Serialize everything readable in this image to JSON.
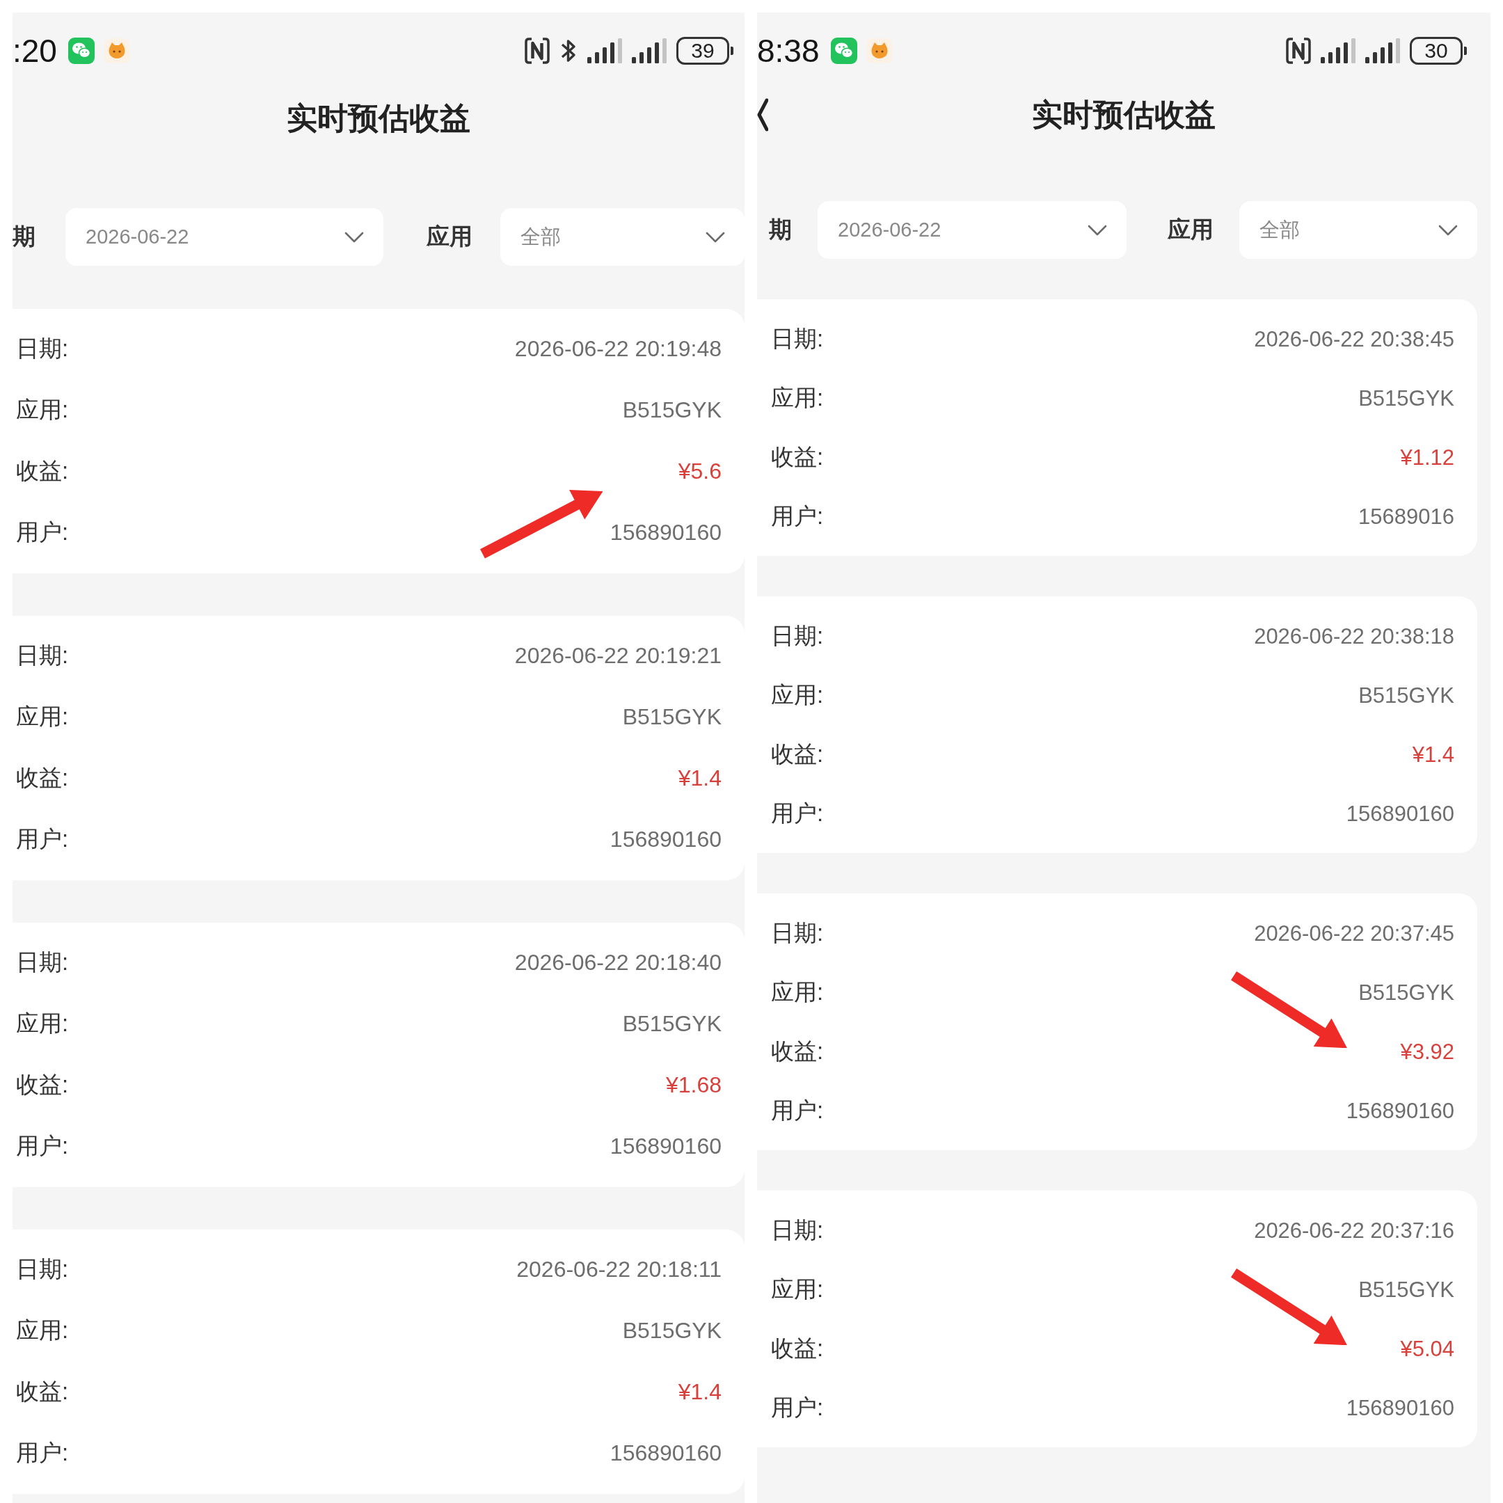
{
  "screens": [
    {
      "status_bar": {
        "time": ":20",
        "bluetooth": true,
        "battery": "39"
      },
      "nav_bar": {
        "title": "实时预估收益"
      },
      "filters": [
        {
          "label": "期",
          "value": "2026-06-22"
        },
        {
          "label": "应用",
          "value": "全部"
        }
      ],
      "records": [
        {
          "arrow": {
            "kind": "up-right"
          },
          "fields": [
            {
              "kind": "text",
              "label": "日期:",
              "value": "2026-06-22 20:19:48"
            },
            {
              "kind": "text",
              "label": "应用:",
              "value": "B515GYK"
            },
            {
              "kind": "amount",
              "label": "收益:",
              "value": "¥5.6"
            },
            {
              "kind": "text",
              "label": "用户:",
              "value": "156890160"
            }
          ]
        },
        {
          "fields": [
            {
              "kind": "text",
              "label": "日期:",
              "value": "2026-06-22 20:19:21"
            },
            {
              "kind": "text",
              "label": "应用:",
              "value": "B515GYK"
            },
            {
              "kind": "amount",
              "label": "收益:",
              "value": "¥1.4"
            },
            {
              "kind": "text",
              "label": "用户:",
              "value": "156890160"
            }
          ]
        },
        {
          "fields": [
            {
              "kind": "text",
              "label": "日期:",
              "value": "2026-06-22 20:18:40"
            },
            {
              "kind": "text",
              "label": "应用:",
              "value": "B515GYK"
            },
            {
              "kind": "amount",
              "label": "收益:",
              "value": "¥1.68"
            },
            {
              "kind": "text",
              "label": "用户:",
              "value": "156890160"
            }
          ]
        },
        {
          "fields": [
            {
              "kind": "text",
              "label": "日期:",
              "value": "2026-06-22 20:18:11"
            },
            {
              "kind": "text",
              "label": "应用:",
              "value": "B515GYK"
            },
            {
              "kind": "amount",
              "label": "收益:",
              "value": "¥1.4"
            },
            {
              "kind": "text",
              "label": "用户:",
              "value": "156890160"
            }
          ]
        }
      ]
    },
    {
      "status_bar": {
        "time": "8:38",
        "battery": "30"
      },
      "nav_bar": {
        "title": "实时预估收益",
        "back_button": true
      },
      "filters": [
        {
          "label": "期",
          "value": "2026-06-22"
        },
        {
          "label": "应用",
          "value": "全部"
        }
      ],
      "records": [
        {
          "fields": [
            {
              "kind": "text",
              "label": "日期:",
              "value": "2026-06-22 20:38:45"
            },
            {
              "kind": "text",
              "label": "应用:",
              "value": "B515GYK"
            },
            {
              "kind": "amount",
              "label": "收益:",
              "value": "¥1.12"
            },
            {
              "kind": "text",
              "label": "用户:",
              "value": "15689016"
            }
          ]
        },
        {
          "fields": [
            {
              "kind": "text",
              "label": "日期:",
              "value": "2026-06-22 20:38:18"
            },
            {
              "kind": "text",
              "label": "应用:",
              "value": "B515GYK"
            },
            {
              "kind": "amount",
              "label": "收益:",
              "value": "¥1.4"
            },
            {
              "kind": "text",
              "label": "用户:",
              "value": "156890160"
            }
          ]
        },
        {
          "arrow": {
            "kind": "down-right"
          },
          "fields": [
            {
              "kind": "text",
              "label": "日期:",
              "value": "2026-06-22 20:37:45"
            },
            {
              "kind": "text",
              "label": "应用:",
              "value": "B515GYK"
            },
            {
              "kind": "amount",
              "label": "收益:",
              "value": "¥3.92"
            },
            {
              "kind": "text",
              "label": "用户:",
              "value": "156890160"
            }
          ]
        },
        {
          "arrow": {
            "kind": "down-right"
          },
          "fields": [
            {
              "kind": "text",
              "label": "日期:",
              "value": "2026-06-22 20:37:16"
            },
            {
              "kind": "text",
              "label": "应用:",
              "value": "B515GYK"
            },
            {
              "kind": "amount",
              "label": "收益:",
              "value": "¥5.04"
            },
            {
              "kind": "text",
              "label": "用户:",
              "value": "156890160"
            }
          ]
        }
      ]
    }
  ]
}
